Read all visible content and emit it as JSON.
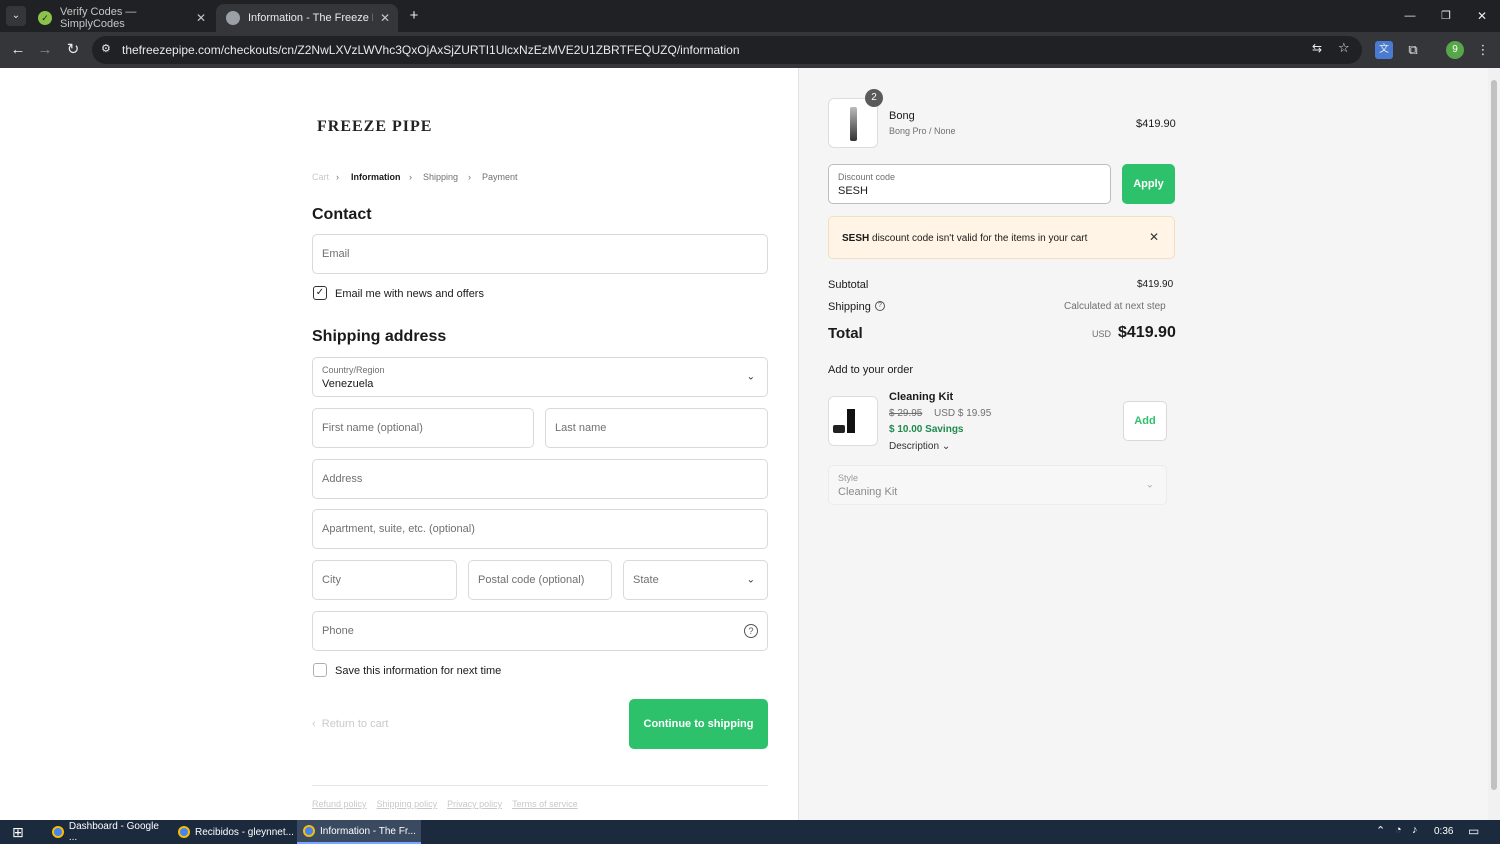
{
  "browser": {
    "tabs": [
      {
        "title": "Verify Codes — SimplyCodes",
        "active": false
      },
      {
        "title": "Information - The Freeze Pipe",
        "active": true
      }
    ],
    "url": "thefreezepipe.com/checkouts/cn/Z2NwLXVzLWVhc3QxOjAxSjZURTI1UlcxNzEzMVE2U1ZBRTFEQUZQ/information",
    "profile_initial": "9"
  },
  "store": {
    "logo_text": "FREEZE PIPE"
  },
  "breadcrumb": {
    "cart": "Cart",
    "information": "Information",
    "shipping": "Shipping",
    "payment": "Payment"
  },
  "contact": {
    "heading": "Contact",
    "email_placeholder": "Email",
    "news_label": "Email me with news and offers",
    "news_checked": true
  },
  "shipping_address": {
    "heading": "Shipping address",
    "country_label": "Country/Region",
    "country_value": "Venezuela",
    "first_name_placeholder": "First name (optional)",
    "last_name_placeholder": "Last name",
    "address_placeholder": "Address",
    "apartment_placeholder": "Apartment, suite, etc. (optional)",
    "city_placeholder": "City",
    "postal_placeholder": "Postal code (optional)",
    "state_placeholder": "State",
    "phone_placeholder": "Phone",
    "save_label": "Save this information for next time"
  },
  "actions": {
    "return_label": "Return to cart",
    "continue_label": "Continue to shipping"
  },
  "footer_links": [
    "Refund policy",
    "Shipping policy",
    "Privacy policy",
    "Terms of service"
  ],
  "order": {
    "item": {
      "quantity": "2",
      "name": "Bong",
      "variant": "Bong Pro / None",
      "price": "$419.90"
    },
    "discount": {
      "label": "Discount code",
      "value": "SESH",
      "apply_label": "Apply"
    },
    "error": {
      "code": "SESH",
      "message": "discount code isn't valid for the items in your cart"
    },
    "subtotal_label": "Subtotal",
    "subtotal_value": "$419.90",
    "shipping_label": "Shipping",
    "shipping_value": "Calculated at next step",
    "total_label": "Total",
    "total_currency": "USD",
    "total_value": "$419.90"
  },
  "upsell": {
    "heading": "Add to your order",
    "name": "Cleaning Kit",
    "old_price": "$ 29.95",
    "new_price": "USD $ 19.95",
    "savings": "$ 10.00 Savings",
    "description_label": "Description",
    "add_label": "Add",
    "style_label": "Style",
    "style_value": "Cleaning Kit"
  },
  "taskbar": {
    "items": [
      "Dashboard - Google ...",
      "Recibidos - gleynnet...",
      "Information - The Fr..."
    ],
    "time": "0:36"
  },
  "colors": {
    "accent_green": "#2ec16b",
    "error_bg": "#fff4e5"
  }
}
